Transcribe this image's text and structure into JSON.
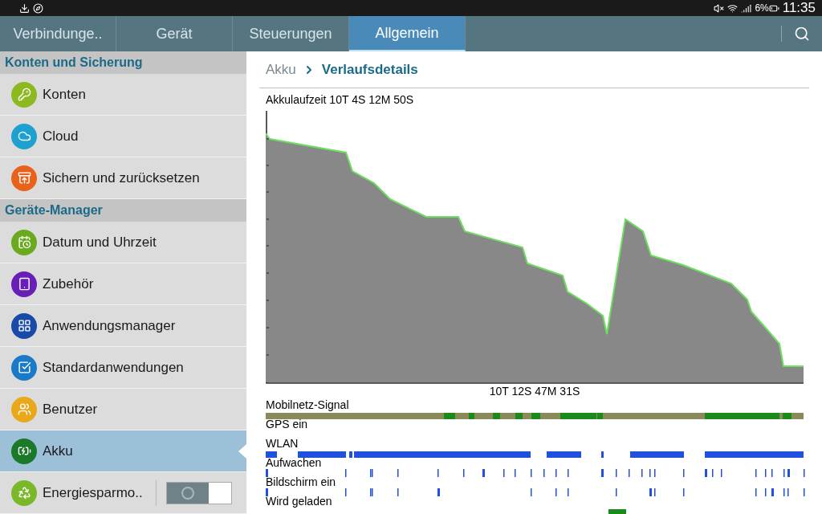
{
  "status_bar": {
    "battery": "6%",
    "time": "11:35"
  },
  "tabs": [
    {
      "label": "Verbindunge..",
      "selected": false
    },
    {
      "label": "Gerät",
      "selected": false
    },
    {
      "label": "Steuerungen",
      "selected": false
    },
    {
      "label": "Allgemein",
      "selected": true
    }
  ],
  "sidebar": {
    "sections": [
      {
        "title": "Konten und Sicherung",
        "items": [
          {
            "label": "Konten",
            "color": "#8cb820",
            "selected": false
          },
          {
            "label": "Cloud",
            "color": "#1ea0d0",
            "selected": false
          },
          {
            "label": "Sichern und zurücksetzen",
            "color": "#e8621c",
            "selected": false
          }
        ]
      },
      {
        "title": "Geräte-Manager",
        "items": [
          {
            "label": "Datum und Uhrzeit",
            "color": "#6aaa1e",
            "selected": false
          },
          {
            "label": "Zubehör",
            "color": "#6a1eb8",
            "selected": false
          },
          {
            "label": "Anwendungsmanager",
            "color": "#1a4aa8",
            "selected": false
          },
          {
            "label": "Standardanwendungen",
            "color": "#1a7ac8",
            "selected": false
          },
          {
            "label": "Benutzer",
            "color": "#e8a81a",
            "selected": false
          },
          {
            "label": "Akku",
            "color": "#1a7a2a",
            "selected": true
          },
          {
            "label": "Energiesparmo..",
            "color": "#7ab82a",
            "selected": false,
            "on": false
          }
        ]
      }
    ]
  },
  "breadcrumb": {
    "parent": "Akku",
    "current": "Verlaufsdetails"
  },
  "battery_chart": {
    "title": "Akkulaufzeit 10T 4S 12M 50S",
    "time_label": "10T 12S 47M 31S"
  },
  "tracks": [
    {
      "kind": "signal",
      "label": "Mobilnetz-Signal"
    },
    {
      "kind": "gps",
      "label": "GPS ein"
    },
    {
      "kind": "wlan",
      "label": "WLAN"
    },
    {
      "kind": "wake",
      "label": "Aufwachen"
    },
    {
      "kind": "screen",
      "label": "Bildschirm ein"
    },
    {
      "kind": "charging",
      "label": "Wird geladen"
    }
  ]
}
